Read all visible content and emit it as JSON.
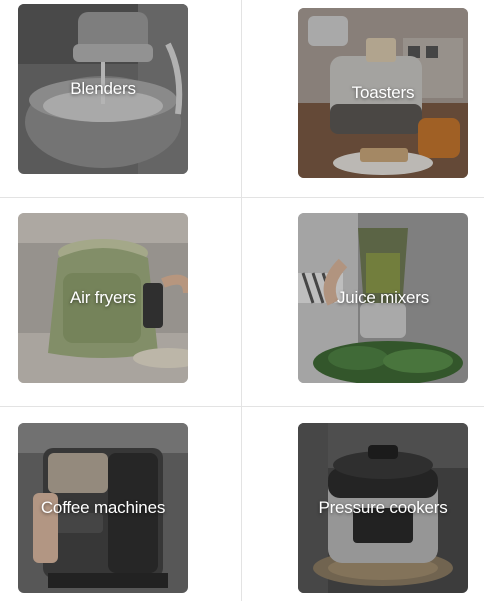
{
  "categories": [
    {
      "label": "Blenders",
      "icon": "stand-mixer-image"
    },
    {
      "label": "Toasters",
      "icon": "toaster-image"
    },
    {
      "label": "Air fryers",
      "icon": "air-fryer-image"
    },
    {
      "label": "Juice mixers",
      "icon": "juice-mixer-image"
    },
    {
      "label": "Coffee machines",
      "icon": "coffee-machine-image"
    },
    {
      "label": "Pressure cookers",
      "icon": "pressure-cooker-image"
    }
  ],
  "colors": {
    "divider": "#e3e3e3",
    "label_text": "#ffffff"
  }
}
